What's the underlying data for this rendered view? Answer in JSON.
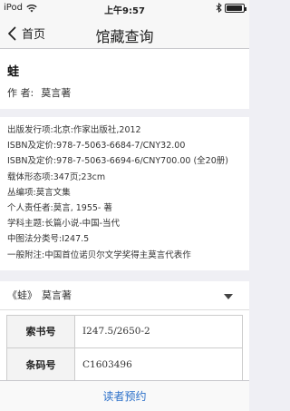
{
  "status_bar": {
    "carrier": "iPod",
    "time": "上午9:57",
    "battery_level": 0.95
  },
  "nav": {
    "back_label": "首页",
    "title": "馆藏查询"
  },
  "book": {
    "title": "蛙",
    "author_label": "作 者:",
    "author": "莫言著"
  },
  "details": [
    "出版发行项:北京:作家出版社,2012",
    "ISBN及定价:978-7-5063-6684-7/CNY32.00",
    "ISBN及定价:978-7-5063-6694-6/CNY700.00 (全20册)",
    "载体形态项:347页;23cm",
    "丛编项:莫言文集",
    "个人责任者:莫言, 1955- 著",
    "学科主题:长篇小说-中国-当代",
    "中图法分类号:I247.5",
    "一般附注:中国首位诺贝尔文学奖得主莫言代表作"
  ],
  "holding": {
    "header_title": "《蛙》",
    "header_author": "莫言著",
    "rows": [
      {
        "label": "索书号",
        "value": "I247.5/2650-2"
      },
      {
        "label": "条码号",
        "value": "C1603496"
      }
    ]
  },
  "bottom": {
    "reserve_label": "读者预约"
  }
}
